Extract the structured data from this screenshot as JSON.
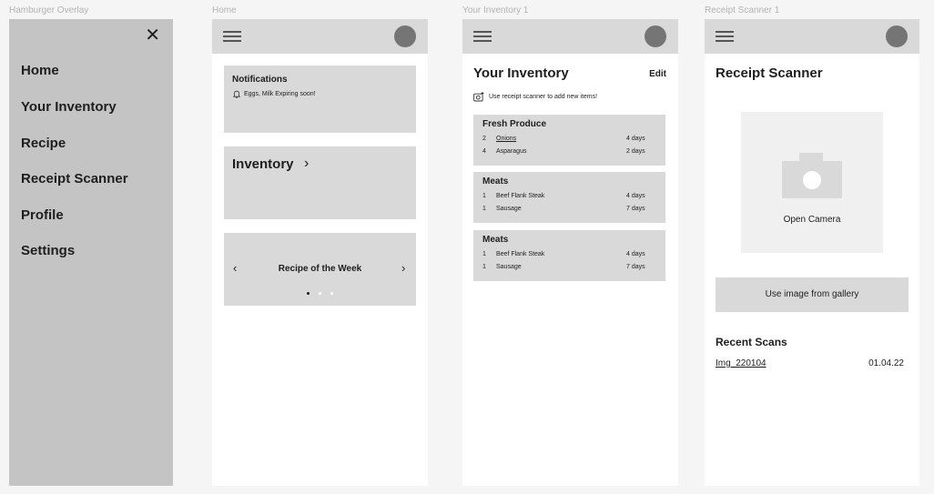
{
  "frame_labels": {
    "hamburger": "Hamburger Overlay",
    "home": "Home",
    "inventory": "Your Inventory 1",
    "scanner": "Receipt Scanner 1"
  },
  "menu": {
    "close": "✕",
    "items": [
      "Home",
      "Your Inventory",
      "Recipe",
      "Receipt Scanner",
      "Profile",
      "Settings"
    ]
  },
  "home": {
    "notifications_title": "Notifications",
    "notification_text": "Eggs, Milk Expiring soon!",
    "inventory_label": "Inventory",
    "inventory_arrow": "›",
    "recipe_label": "Recipe of the Week",
    "prev": "‹",
    "next": "›",
    "carousel": {
      "count": 3,
      "active": 1
    }
  },
  "inventory": {
    "title": "Your Inventory",
    "edit": "Edit",
    "hint": "Use receipt scanner to add new items!",
    "groups": [
      {
        "name": "Fresh Produce",
        "items": [
          {
            "qty": "2",
            "name": "Onions",
            "days": "4 days",
            "underline": true
          },
          {
            "qty": "4",
            "name": "Asparagus",
            "days": "2 days",
            "underline": false
          }
        ]
      },
      {
        "name": "Meats",
        "items": [
          {
            "qty": "1",
            "name": "Beef Flank Steak",
            "days": "4 days",
            "underline": false
          },
          {
            "qty": "1",
            "name": "Sausage",
            "days": "7 days",
            "underline": false
          }
        ]
      },
      {
        "name": "Meats",
        "items": [
          {
            "qty": "1",
            "name": "Beef Flank Steak",
            "days": "4 days",
            "underline": false
          },
          {
            "qty": "1",
            "name": "Sausage",
            "days": "7 days",
            "underline": false
          }
        ]
      }
    ]
  },
  "scanner": {
    "title": "Receipt Scanner",
    "open_camera": "Open Camera",
    "gallery_button": "Use image from gallery",
    "recent_title": "Recent Scans",
    "recent": [
      {
        "file": "Img_220104",
        "date": "01.04.22"
      }
    ]
  },
  "colors": {
    "background": "#f5f5f5",
    "overlay": "#c4c4c4",
    "card": "#d9d9d9",
    "avatar": "#757575"
  }
}
